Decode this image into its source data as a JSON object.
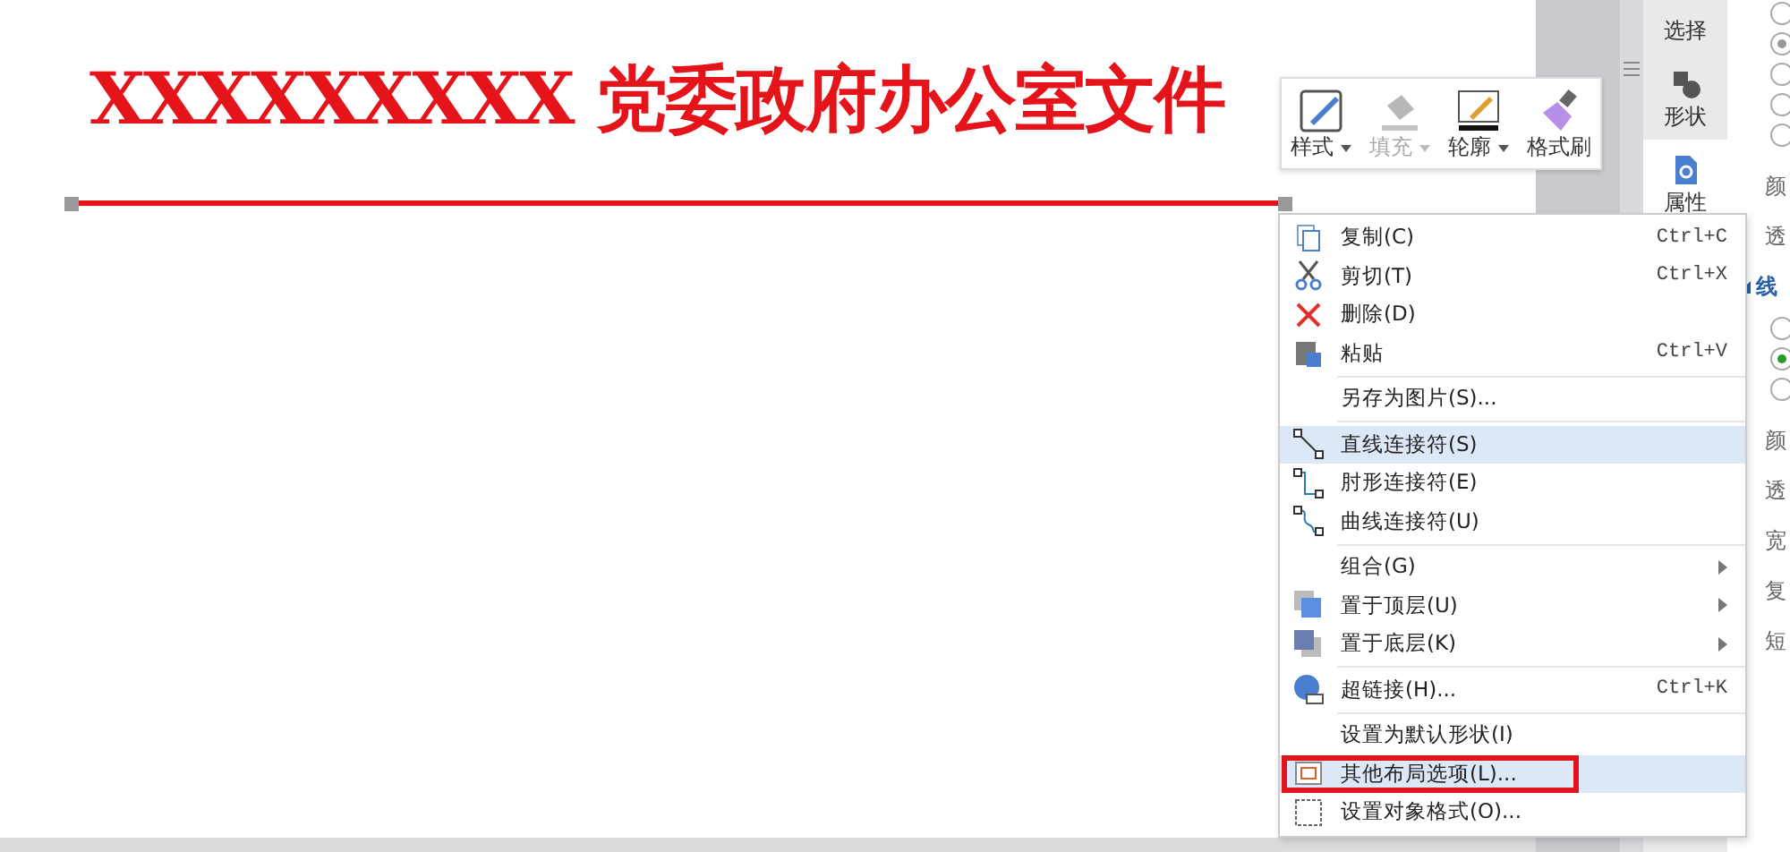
{
  "document": {
    "heading": "XXXXXXXXX 党委政府办公室文件"
  },
  "float_toolbar": [
    {
      "label": "样式",
      "disabled": false,
      "caret": true
    },
    {
      "label": "填充",
      "disabled": true,
      "caret": true
    },
    {
      "label": "轮廓",
      "disabled": false,
      "caret": true
    },
    {
      "label": "格式刷",
      "disabled": false,
      "caret": false
    }
  ],
  "context_menu": [
    {
      "kind": "item",
      "label": "复制(C)",
      "shortcut": "Ctrl+C",
      "submenu": false,
      "selected": false,
      "outlined": false
    },
    {
      "kind": "item",
      "label": "剪切(T)",
      "shortcut": "Ctrl+X",
      "submenu": false,
      "selected": false,
      "outlined": false
    },
    {
      "kind": "item",
      "label": "删除(D)",
      "submenu": false,
      "selected": false,
      "outlined": false
    },
    {
      "kind": "item",
      "label": "粘贴",
      "shortcut": "Ctrl+V",
      "submenu": false,
      "selected": false,
      "outlined": false
    },
    {
      "kind": "separator"
    },
    {
      "kind": "item",
      "label": "另存为图片(S)...",
      "submenu": false,
      "selected": false,
      "outlined": false
    },
    {
      "kind": "separator"
    },
    {
      "kind": "item",
      "label": "直线连接符(S)",
      "submenu": false,
      "selected": true,
      "outlined": false
    },
    {
      "kind": "item",
      "label": "肘形连接符(E)",
      "submenu": false,
      "selected": false,
      "outlined": false
    },
    {
      "kind": "item",
      "label": "曲线连接符(U)",
      "submenu": false,
      "selected": false,
      "outlined": false
    },
    {
      "kind": "separator"
    },
    {
      "kind": "item",
      "label": "组合(G)",
      "submenu": true,
      "selected": false,
      "outlined": false
    },
    {
      "kind": "item",
      "label": "置于顶层(U)",
      "submenu": true,
      "selected": false,
      "outlined": false
    },
    {
      "kind": "item",
      "label": "置于底层(K)",
      "submenu": true,
      "selected": false,
      "outlined": false
    },
    {
      "kind": "separator"
    },
    {
      "kind": "item",
      "label": "超链接(H)...",
      "shortcut": "Ctrl+K",
      "submenu": false,
      "selected": false,
      "outlined": false
    },
    {
      "kind": "separator"
    },
    {
      "kind": "item",
      "label": "设置为默认形状(I)",
      "submenu": false,
      "selected": false,
      "outlined": false
    },
    {
      "kind": "item",
      "label": "其他布局选项(L)...",
      "submenu": false,
      "selected": true,
      "outlined": true
    },
    {
      "kind": "item",
      "label": "设置对象格式(O)...",
      "submenu": false,
      "selected": false,
      "outlined": false
    }
  ],
  "side_tabs": [
    {
      "label": "选择",
      "selected": false
    },
    {
      "label": "形状",
      "selected": false
    },
    {
      "label": "属性",
      "selected": true
    }
  ],
  "property_panel": [
    {
      "kind": "radios",
      "options": [
        {
          "selected": false
        },
        {
          "selected": true
        },
        {
          "selected": false
        },
        {
          "selected": false
        },
        {
          "selected": false
        }
      ]
    },
    {
      "kind": "label",
      "text": "颜"
    },
    {
      "kind": "label",
      "text": "透"
    },
    {
      "kind": "section",
      "text": "线"
    },
    {
      "kind": "radios",
      "options": [
        {
          "selected": false
        },
        {
          "selected": true
        },
        {
          "selected": false
        }
      ]
    },
    {
      "kind": "label",
      "text": "颜"
    },
    {
      "kind": "label",
      "text": "透"
    },
    {
      "kind": "label",
      "text": "宽"
    },
    {
      "kind": "label",
      "text": "复"
    },
    {
      "kind": "label",
      "text": "短"
    }
  ]
}
